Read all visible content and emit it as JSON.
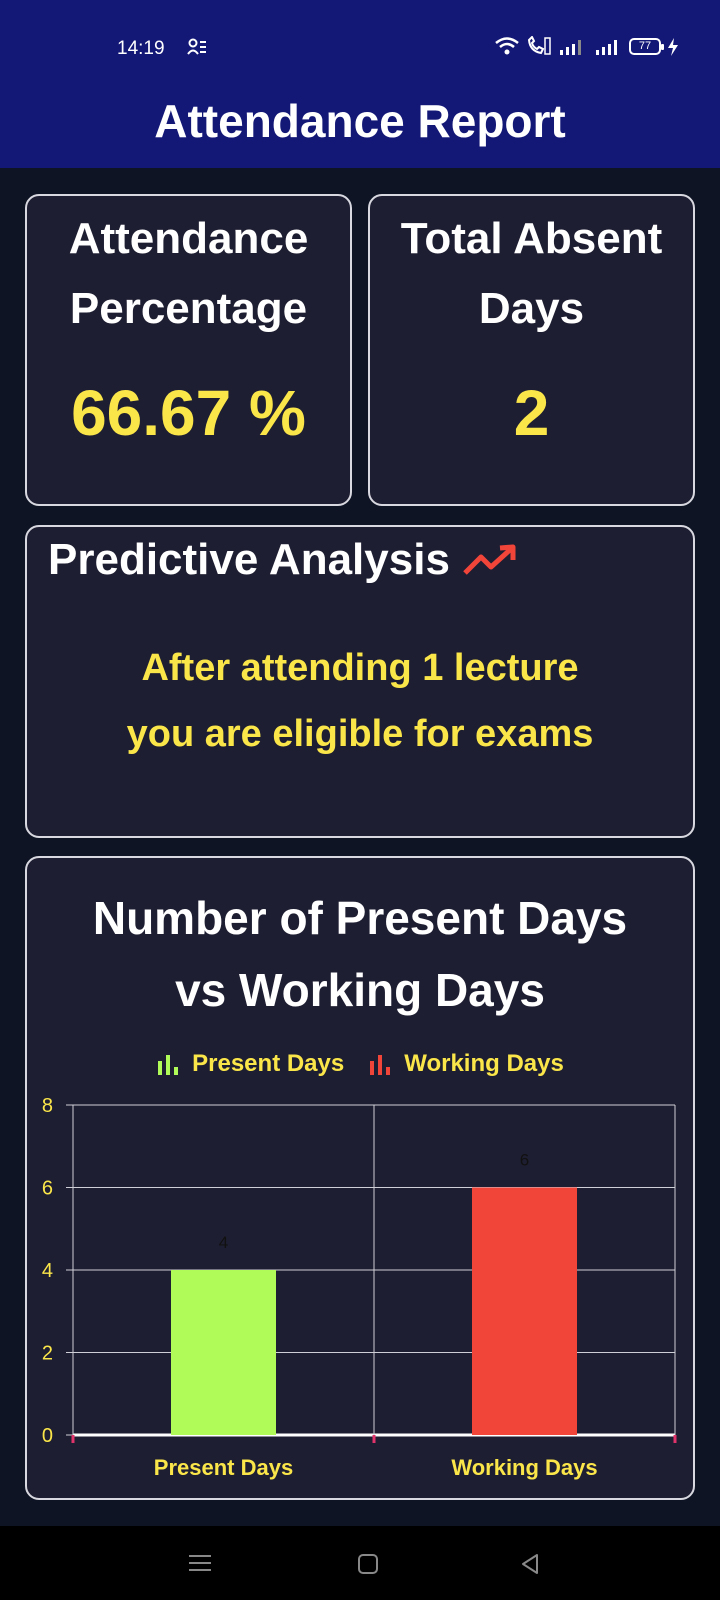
{
  "status_bar": {
    "time": "14:19",
    "battery": "77"
  },
  "header": {
    "title": "Attendance Report"
  },
  "cards": {
    "attendance": {
      "label_line1": "Attendance",
      "label_line2": "Percentage",
      "value": "66.67 %"
    },
    "absent": {
      "label_line1": "Total Absent",
      "label_line2": "Days",
      "value": "2"
    }
  },
  "predictive": {
    "title": "Predictive Analysis",
    "line1": "After attending 1 lecture",
    "line2": "you are eligible for exams"
  },
  "chart_card": {
    "title_line1": "Number of Present Days",
    "title_line2": "vs Working Days"
  },
  "colors": {
    "present": "#b0fb58",
    "working": "#f2453a",
    "accent_yellow": "#fbe64a"
  },
  "chart_data": {
    "type": "bar",
    "categories": [
      "Present Days",
      "Working Days"
    ],
    "values": [
      4,
      6
    ],
    "legend": [
      "Present Days",
      "Working Days"
    ],
    "ylim": [
      0,
      8
    ],
    "yticks": [
      0,
      2,
      4,
      6,
      8
    ],
    "grid": true,
    "legend_position": "top"
  }
}
